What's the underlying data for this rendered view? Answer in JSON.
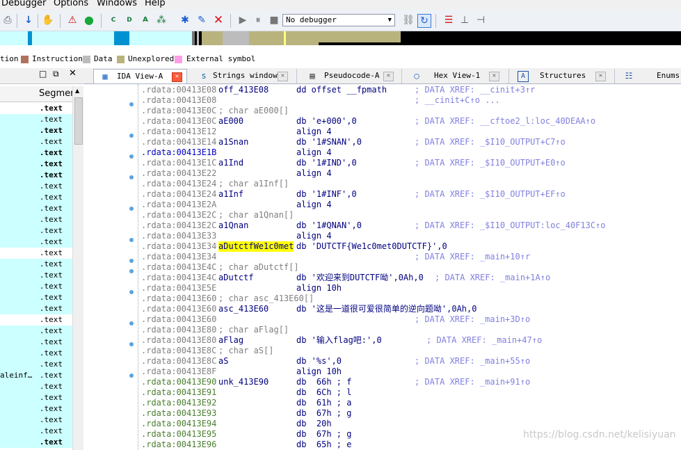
{
  "menubar": {
    "items": [
      "Debugger",
      "Options",
      "Windows",
      "Help"
    ]
  },
  "toolbar": {
    "debugger_select": "No debugger",
    "icons": [
      "download-arrow-icon",
      "hand-lock-icon",
      "warning-triangle-icon",
      "green-circle-icon",
      "code-icon",
      "data-icon",
      "string-icon",
      "xref-icon",
      "star-icon",
      "rename-icon",
      "delete-x-icon",
      "play-icon",
      "pause-icon",
      "stop-icon",
      "attach-icon",
      "breakpoint-icon",
      "switch-icon",
      "trace-icon"
    ]
  },
  "legend": {
    "items": [
      {
        "label": "tion",
        "color": ""
      },
      {
        "label": "Instruction",
        "color": "#b0725a"
      },
      {
        "label": "Data",
        "color": "#bcbcbc"
      },
      {
        "label": "Unexplored",
        "color": "#b9b37d"
      },
      {
        "label": "External symbol",
        "color": "#ff9ee5"
      }
    ]
  },
  "left_panel": {
    "column_header": "Segmer",
    "rows": [
      {
        "name": "",
        "seg": ".text",
        "bold": true,
        "white": true
      },
      {
        "name": "",
        "seg": ".text",
        "bold": false,
        "white": false
      },
      {
        "name": "",
        "seg": ".text",
        "bold": true,
        "white": false
      },
      {
        "name": "",
        "seg": ".text",
        "bold": false,
        "white": false
      },
      {
        "name": "",
        "seg": ".text",
        "bold": true,
        "white": false
      },
      {
        "name": "",
        "seg": ".text",
        "bold": true,
        "white": false
      },
      {
        "name": "",
        "seg": ".text",
        "bold": true,
        "white": false
      },
      {
        "name": "",
        "seg": ".text",
        "bold": false,
        "white": false
      },
      {
        "name": "",
        "seg": ".text",
        "bold": false,
        "white": false
      },
      {
        "name": "",
        "seg": ".text",
        "bold": false,
        "white": false
      },
      {
        "name": "",
        "seg": ".text",
        "bold": false,
        "white": false
      },
      {
        "name": "",
        "seg": ".text",
        "bold": false,
        "white": false
      },
      {
        "name": "",
        "seg": ".text",
        "bold": false,
        "white": false
      },
      {
        "name": "",
        "seg": ".text",
        "bold": false,
        "white": true
      },
      {
        "name": "",
        "seg": ".text",
        "bold": false,
        "white": false
      },
      {
        "name": "",
        "seg": ".text",
        "bold": false,
        "white": false
      },
      {
        "name": "",
        "seg": ".text",
        "bold": false,
        "white": false
      },
      {
        "name": "",
        "seg": ".text",
        "bold": false,
        "white": false
      },
      {
        "name": "",
        "seg": ".text",
        "bold": false,
        "white": false
      },
      {
        "name": "",
        "seg": ".text",
        "bold": false,
        "white": true
      },
      {
        "name": "",
        "seg": ".text",
        "bold": false,
        "white": false
      },
      {
        "name": "",
        "seg": ".text",
        "bold": false,
        "white": false
      },
      {
        "name": "",
        "seg": ".text",
        "bold": false,
        "white": false
      },
      {
        "name": "",
        "seg": ".text",
        "bold": false,
        "white": false
      },
      {
        "name": "aleinf…",
        "seg": ".text",
        "bold": false,
        "white": false
      },
      {
        "name": "",
        "seg": ".text",
        "bold": false,
        "white": false
      },
      {
        "name": "",
        "seg": ".text",
        "bold": false,
        "white": false
      },
      {
        "name": "",
        "seg": ".text",
        "bold": false,
        "white": false
      },
      {
        "name": "",
        "seg": ".text",
        "bold": false,
        "white": false
      },
      {
        "name": "",
        "seg": ".text",
        "bold": false,
        "white": false
      },
      {
        "name": "",
        "seg": ".text",
        "bold": true,
        "white": false
      }
    ]
  },
  "tabs": [
    {
      "label": "IDA View-A",
      "icon": "ida-view-icon",
      "active": true
    },
    {
      "label": "Strings window",
      "icon": "strings-icon",
      "active": false
    },
    {
      "label": "Pseudocode-A",
      "icon": "pseudocode-icon",
      "active": false
    },
    {
      "label": "Hex View-1",
      "icon": "hex-view-icon",
      "active": false
    },
    {
      "label": "Structures",
      "icon": "structures-icon",
      "active": false
    },
    {
      "label": "Enums",
      "icon": "enums-icon",
      "active": false
    }
  ],
  "disasm": {
    "lines": [
      {
        "addr": ".rdata:00413E08",
        "color": "gray",
        "name": "off_413E08",
        "mn": "dd offset __fpmath",
        "comment": "; DATA XREF: __cinit+3↑r",
        "dot": false
      },
      {
        "addr": ".rdata:00413E08",
        "color": "gray",
        "name": "",
        "mn": "",
        "comment": "; __cinit+C↑o ...",
        "dot": false
      },
      {
        "addr": ".rdata:00413E0C",
        "color": "gray",
        "name": "; char aE000[]",
        "mn": "",
        "comment": "",
        "dot": true
      },
      {
        "addr": ".rdata:00413E0C",
        "color": "gray",
        "name": "aE000",
        "mn": "db 'e+000',0",
        "comment": "; DATA XREF: __cftoe2_l:loc_40DEAA↑o",
        "dot": false
      },
      {
        "addr": ".rdata:00413E12",
        "color": "gray",
        "name": "",
        "mn": "align 4",
        "comment": "",
        "dot": false
      },
      {
        "addr": ".rdata:00413E14",
        "color": "gray",
        "name": "a1Snan",
        "mn": "db '1#SNAN',0",
        "comment": "; DATA XREF: _$I10_OUTPUT+C7↑o",
        "dot": true
      },
      {
        "addr": ".rdata:00413E1B",
        "color": "blue",
        "name": "",
        "mn": "align 4",
        "comment": "",
        "dot": false
      },
      {
        "addr": ".rdata:00413E1C",
        "color": "gray",
        "name": "a1Ind",
        "mn": "db '1#IND',0",
        "comment": "; DATA XREF: _$I10_OUTPUT+E0↑o",
        "dot": true
      },
      {
        "addr": ".rdata:00413E22",
        "color": "gray",
        "name": "",
        "mn": "align 4",
        "comment": "",
        "dot": false
      },
      {
        "addr": ".rdata:00413E24",
        "color": "gray",
        "name": "; char a1Inf[]",
        "mn": "",
        "comment": "",
        "dot": true
      },
      {
        "addr": ".rdata:00413E24",
        "color": "gray",
        "name": "a1Inf",
        "mn": "db '1#INF',0",
        "comment": "; DATA XREF: _$I10_OUTPUT+EF↑o",
        "dot": false
      },
      {
        "addr": ".rdata:00413E2A",
        "color": "gray",
        "name": "",
        "mn": "align 4",
        "comment": "",
        "dot": false
      },
      {
        "addr": ".rdata:00413E2C",
        "color": "gray",
        "name": "; char a1Qnan[]",
        "mn": "",
        "comment": "",
        "dot": true
      },
      {
        "addr": ".rdata:00413E2C",
        "color": "gray",
        "name": "a1Qnan",
        "mn": "db '1#QNAN',0",
        "comment": "; DATA XREF: _$I10_OUTPUT:loc_40F13C↑o",
        "dot": false
      },
      {
        "addr": ".rdata:00413E33",
        "color": "gray",
        "name": "",
        "mn": "align 4",
        "comment": "",
        "dot": false
      },
      {
        "addr": ".rdata:00413E34",
        "color": "gray",
        "name": "aDutctfWe1c0met",
        "mn": "db 'DUTCTF{We1c0met0DUTCTF}',0",
        "comment": "",
        "dot": true,
        "highlight": true
      },
      {
        "addr": ".rdata:00413E34",
        "color": "gray",
        "name": "",
        "mn": "",
        "comment": "; DATA XREF: _main+10↑r",
        "dot": false
      },
      {
        "addr": ".rdata:00413E4C",
        "color": "gray",
        "name": "; char aDutctf[]",
        "mn": "",
        "comment": "",
        "dot": true
      },
      {
        "addr": ".rdata:00413E4C",
        "color": "gray",
        "name": "aDutctf",
        "mn": "db '欢迎来到DUTCTF呦',0Ah,0",
        "comment": "; DATA XREF: _main+1A↑o",
        "dot": true
      },
      {
        "addr": ".rdata:00413E5E",
        "color": "gray",
        "name": "",
        "mn": "align 10h",
        "comment": "",
        "dot": false
      },
      {
        "addr": ".rdata:00413E60",
        "color": "gray",
        "name": "; char asc_413E60[]",
        "mn": "",
        "comment": "",
        "dot": true
      },
      {
        "addr": ".rdata:00413E60",
        "color": "gray",
        "name": "asc_413E60",
        "mn": "db '这是一道很可爱很简单的逆向题呦',0Ah,0",
        "comment": "",
        "dot": false
      },
      {
        "addr": ".rdata:00413E60",
        "color": "gray",
        "name": "",
        "mn": "",
        "comment": "; DATA XREF: _main+3D↑o",
        "dot": false
      },
      {
        "addr": ".rdata:00413E80",
        "color": "gray",
        "name": "; char aFlag[]",
        "mn": "",
        "comment": "",
        "dot": true
      },
      {
        "addr": ".rdata:00413E80",
        "color": "gray",
        "name": "aFlag",
        "mn": "db '输入flag吧:',0",
        "comment": "; DATA XREF: _main+47↑o",
        "dot": false
      },
      {
        "addr": ".rdata:00413E8C",
        "color": "gray",
        "name": "; char aS[]",
        "mn": "",
        "comment": "",
        "dot": true
      },
      {
        "addr": ".rdata:00413E8C",
        "color": "gray",
        "name": "aS",
        "mn": "db '%s',0",
        "comment": "; DATA XREF: _main+55↑o",
        "dot": false
      },
      {
        "addr": ".rdata:00413E8F",
        "color": "gray",
        "name": "",
        "mn": "align 10h",
        "comment": "",
        "dot": false
      },
      {
        "addr": ".rdata:00413E90",
        "color": "green",
        "name": "unk_413E90",
        "mn": "db  66h ; f",
        "comment": "; DATA XREF: _main+91↑o",
        "dot": true
      },
      {
        "addr": ".rdata:00413E91",
        "color": "green",
        "name": "",
        "mn": "db  6Ch ; l",
        "comment": "",
        "dot": false
      },
      {
        "addr": ".rdata:00413E92",
        "color": "green",
        "name": "",
        "mn": "db  61h ; a",
        "comment": "",
        "dot": false
      },
      {
        "addr": ".rdata:00413E93",
        "color": "green",
        "name": "",
        "mn": "db  67h ; g",
        "comment": "",
        "dot": false
      },
      {
        "addr": ".rdata:00413E94",
        "color": "green",
        "name": "",
        "mn": "db  20h",
        "comment": "",
        "dot": false
      },
      {
        "addr": ".rdata:00413E95",
        "color": "green",
        "name": "",
        "mn": "db  67h ; g",
        "comment": "",
        "dot": false
      },
      {
        "addr": ".rdata:00413E96",
        "color": "green",
        "name": "",
        "mn": "db  65h ; e",
        "comment": "",
        "dot": false
      }
    ]
  },
  "watermark": "https://blog.csdn.net/kelisiyuan"
}
